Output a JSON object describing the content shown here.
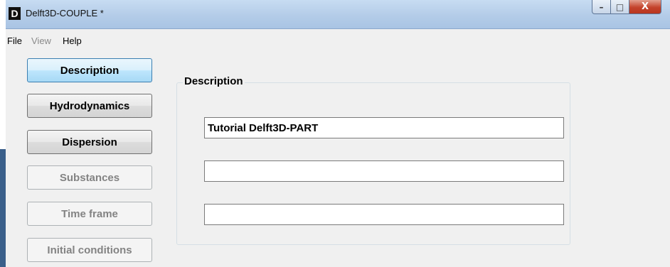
{
  "window": {
    "icon_letter": "D",
    "title": "Delft3D-COUPLE *",
    "controls": {
      "minimize": "–",
      "maximize": "□",
      "close": "X"
    }
  },
  "menu": {
    "items": [
      {
        "label": "File",
        "enabled": true
      },
      {
        "label": "View",
        "enabled": false
      },
      {
        "label": "Help",
        "enabled": true
      }
    ]
  },
  "nav": {
    "buttons": [
      {
        "label": "Description",
        "state": "active"
      },
      {
        "label": "Hydrodynamics",
        "state": "enabled"
      },
      {
        "label": "Dispersion",
        "state": "enabled"
      },
      {
        "label": "Substances",
        "state": "disabled"
      },
      {
        "label": "Time frame",
        "state": "disabled"
      },
      {
        "label": "Initial conditions",
        "state": "disabled"
      }
    ]
  },
  "description_panel": {
    "group_label": "Description",
    "fields": [
      {
        "value": "Tutorial Delft3D-PART"
      },
      {
        "value": ""
      },
      {
        "value": ""
      }
    ]
  }
}
